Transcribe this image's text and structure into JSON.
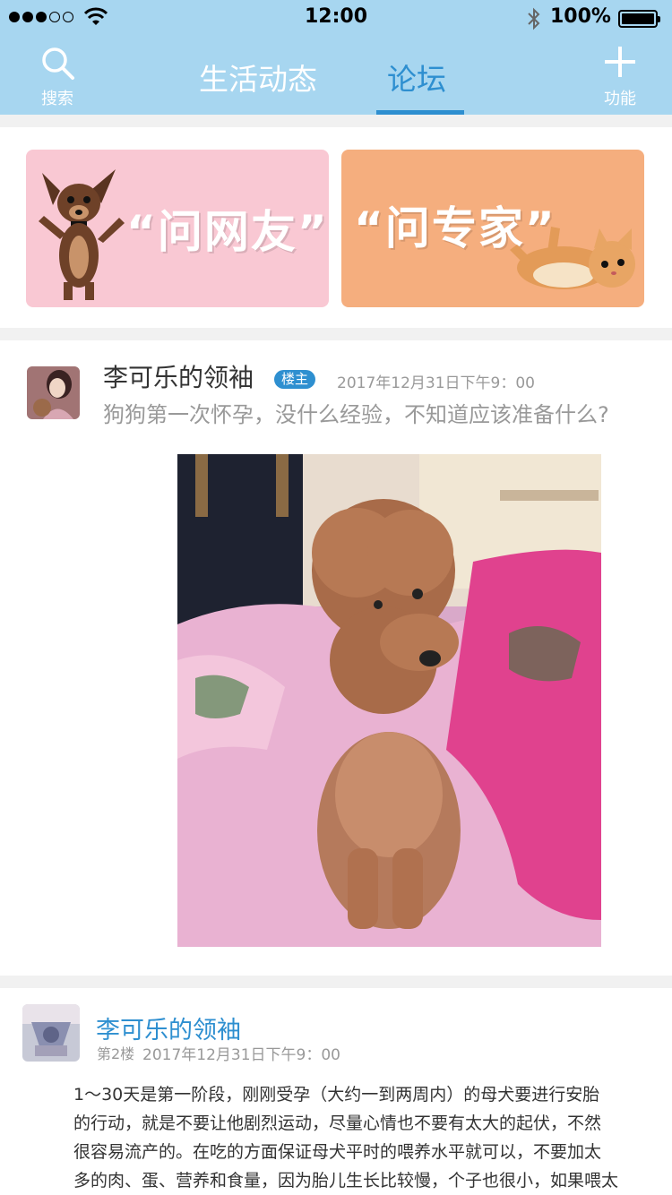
{
  "status_bar": {
    "time": "12:00",
    "battery": "100%"
  },
  "header": {
    "search_label": "搜索",
    "tabs": [
      {
        "label": "生活动态",
        "active": false
      },
      {
        "label": "论坛",
        "active": true
      }
    ],
    "function_label": "功能"
  },
  "banners": [
    {
      "text": "“问网友”",
      "color": "#f9c8d3"
    },
    {
      "text": "“问专家”",
      "color": "#f5ae7e"
    }
  ],
  "post": {
    "author": "李可乐的领袖",
    "badge": "楼主",
    "date": "2017年12月31日下午9：00",
    "question": "狗狗第一次怀孕，没什么经验，不知道应该准备什么?"
  },
  "reply": {
    "author": "李可乐的领袖",
    "floor": "第2楼",
    "date": "2017年12月31日下午9：00",
    "lines": [
      "1～30天是第一阶段，刚刚受孕（大约一到两周内）的母犬要进行安胎",
      "的行动，就是不要让他剧烈运动，尽量心情也不要有太大的起伏，不然",
      "很容易流产的。在吃的方面保证母犬平时的喂养水平就可以，不要加太",
      "多的肉、蛋、营养和食量，因为胎儿生长比较慢，个子也很小，如果喂太"
    ]
  },
  "colors": {
    "header_bg": "#a7d6f0",
    "accent": "#2e8fd0"
  }
}
